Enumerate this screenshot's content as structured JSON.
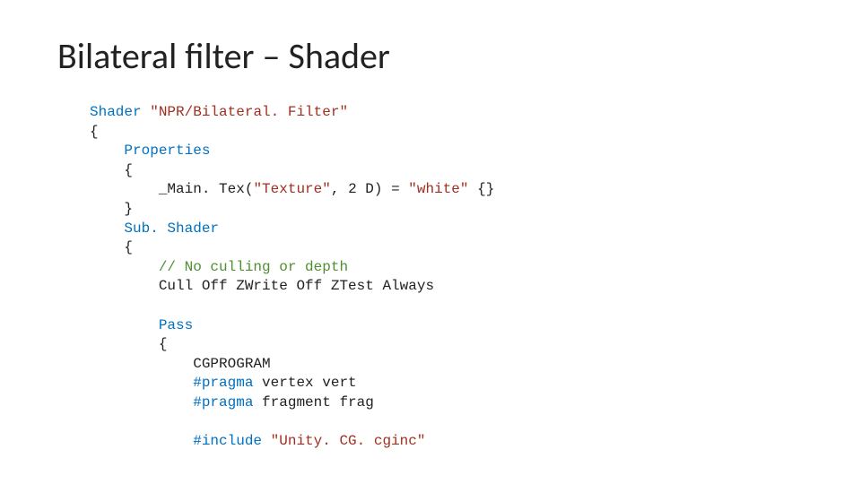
{
  "title": "Bilateral filter – Shader",
  "code": {
    "l1_kw": "Shader",
    "l1_sp": " ",
    "l1_str": "\"NPR/Bilateral. Filter\"",
    "l2": "{",
    "l3_pad": "    ",
    "l3_kw": "Properties",
    "l4": "    {",
    "l5_pad": "        ",
    "l5_a": "_Main. Tex(",
    "l5_str1": "\"Texture\"",
    "l5_b": ", 2 D) = ",
    "l5_str2": "\"white\"",
    "l5_c": " {}",
    "l6": "    }",
    "l7_pad": "    ",
    "l7_kw": "Sub. Shader",
    "l8": "    {",
    "l9_pad": "        ",
    "l9_cmt": "// No culling or depth",
    "l10_pad": "        ",
    "l10": "Cull Off ZWrite Off ZTest Always",
    "l11": "",
    "l12_pad": "        ",
    "l12_kw": "Pass",
    "l13": "        {",
    "l14_pad": "            ",
    "l14": "CGPROGRAM",
    "l15_pad": "            ",
    "l15_kw": "#pragma",
    "l15_b": " vertex vert",
    "l16_pad": "            ",
    "l16_kw": "#pragma",
    "l16_b": " fragment frag",
    "l17": "",
    "l18_pad": "            ",
    "l18_kw": "#include",
    "l18_sp": " ",
    "l18_str": "\"Unity. CG. cginc\""
  }
}
